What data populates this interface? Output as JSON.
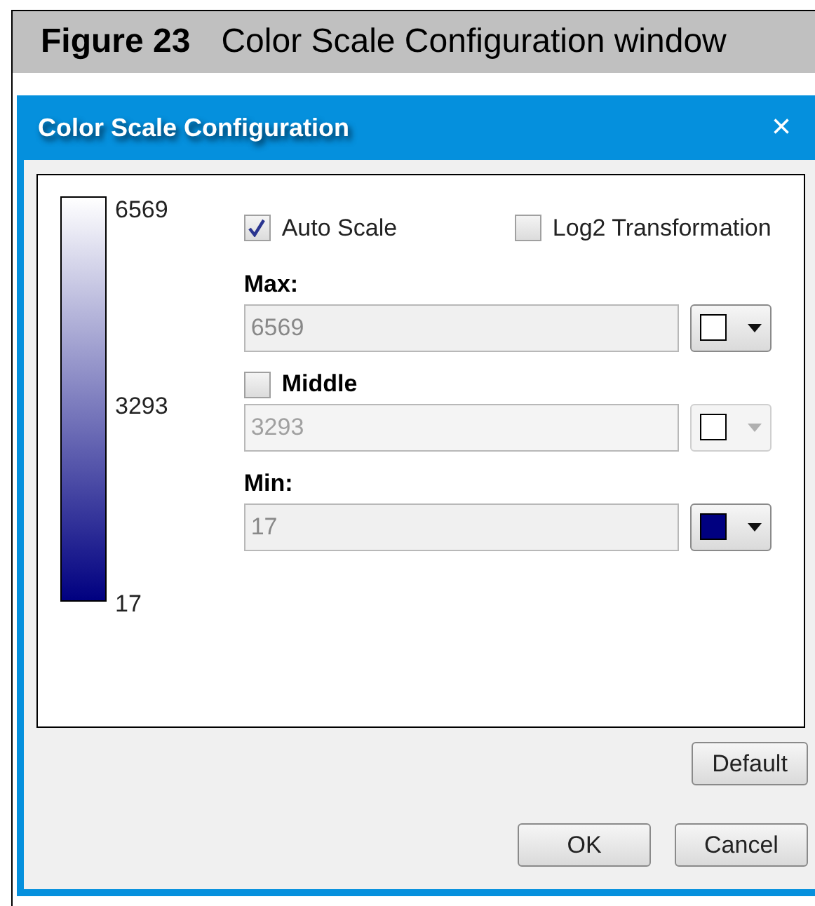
{
  "caption": {
    "label": "Figure 23",
    "title": "Color Scale Configuration window"
  },
  "window": {
    "title": "Color Scale Configuration",
    "close": "×"
  },
  "scale": {
    "labels": [
      "6569",
      "3293",
      "17"
    ]
  },
  "options": [
    {
      "label": "Auto Scale",
      "checked": true
    },
    {
      "label": "Log2 Transformation",
      "checked": false
    }
  ],
  "thresholds": [
    {
      "kind": "label",
      "label": "Max:",
      "value": "6569",
      "color": "#ffffff",
      "disabled": false
    },
    {
      "kind": "checkbox",
      "label": "Middle",
      "checked": false,
      "value": "3293",
      "color": "#ffffff",
      "disabled": true
    },
    {
      "kind": "label",
      "label": "Min:",
      "value": "17",
      "color": "#000080",
      "disabled": false
    }
  ],
  "buttons": {
    "default": "Default",
    "ok": "OK",
    "cancel": "Cancel"
  }
}
